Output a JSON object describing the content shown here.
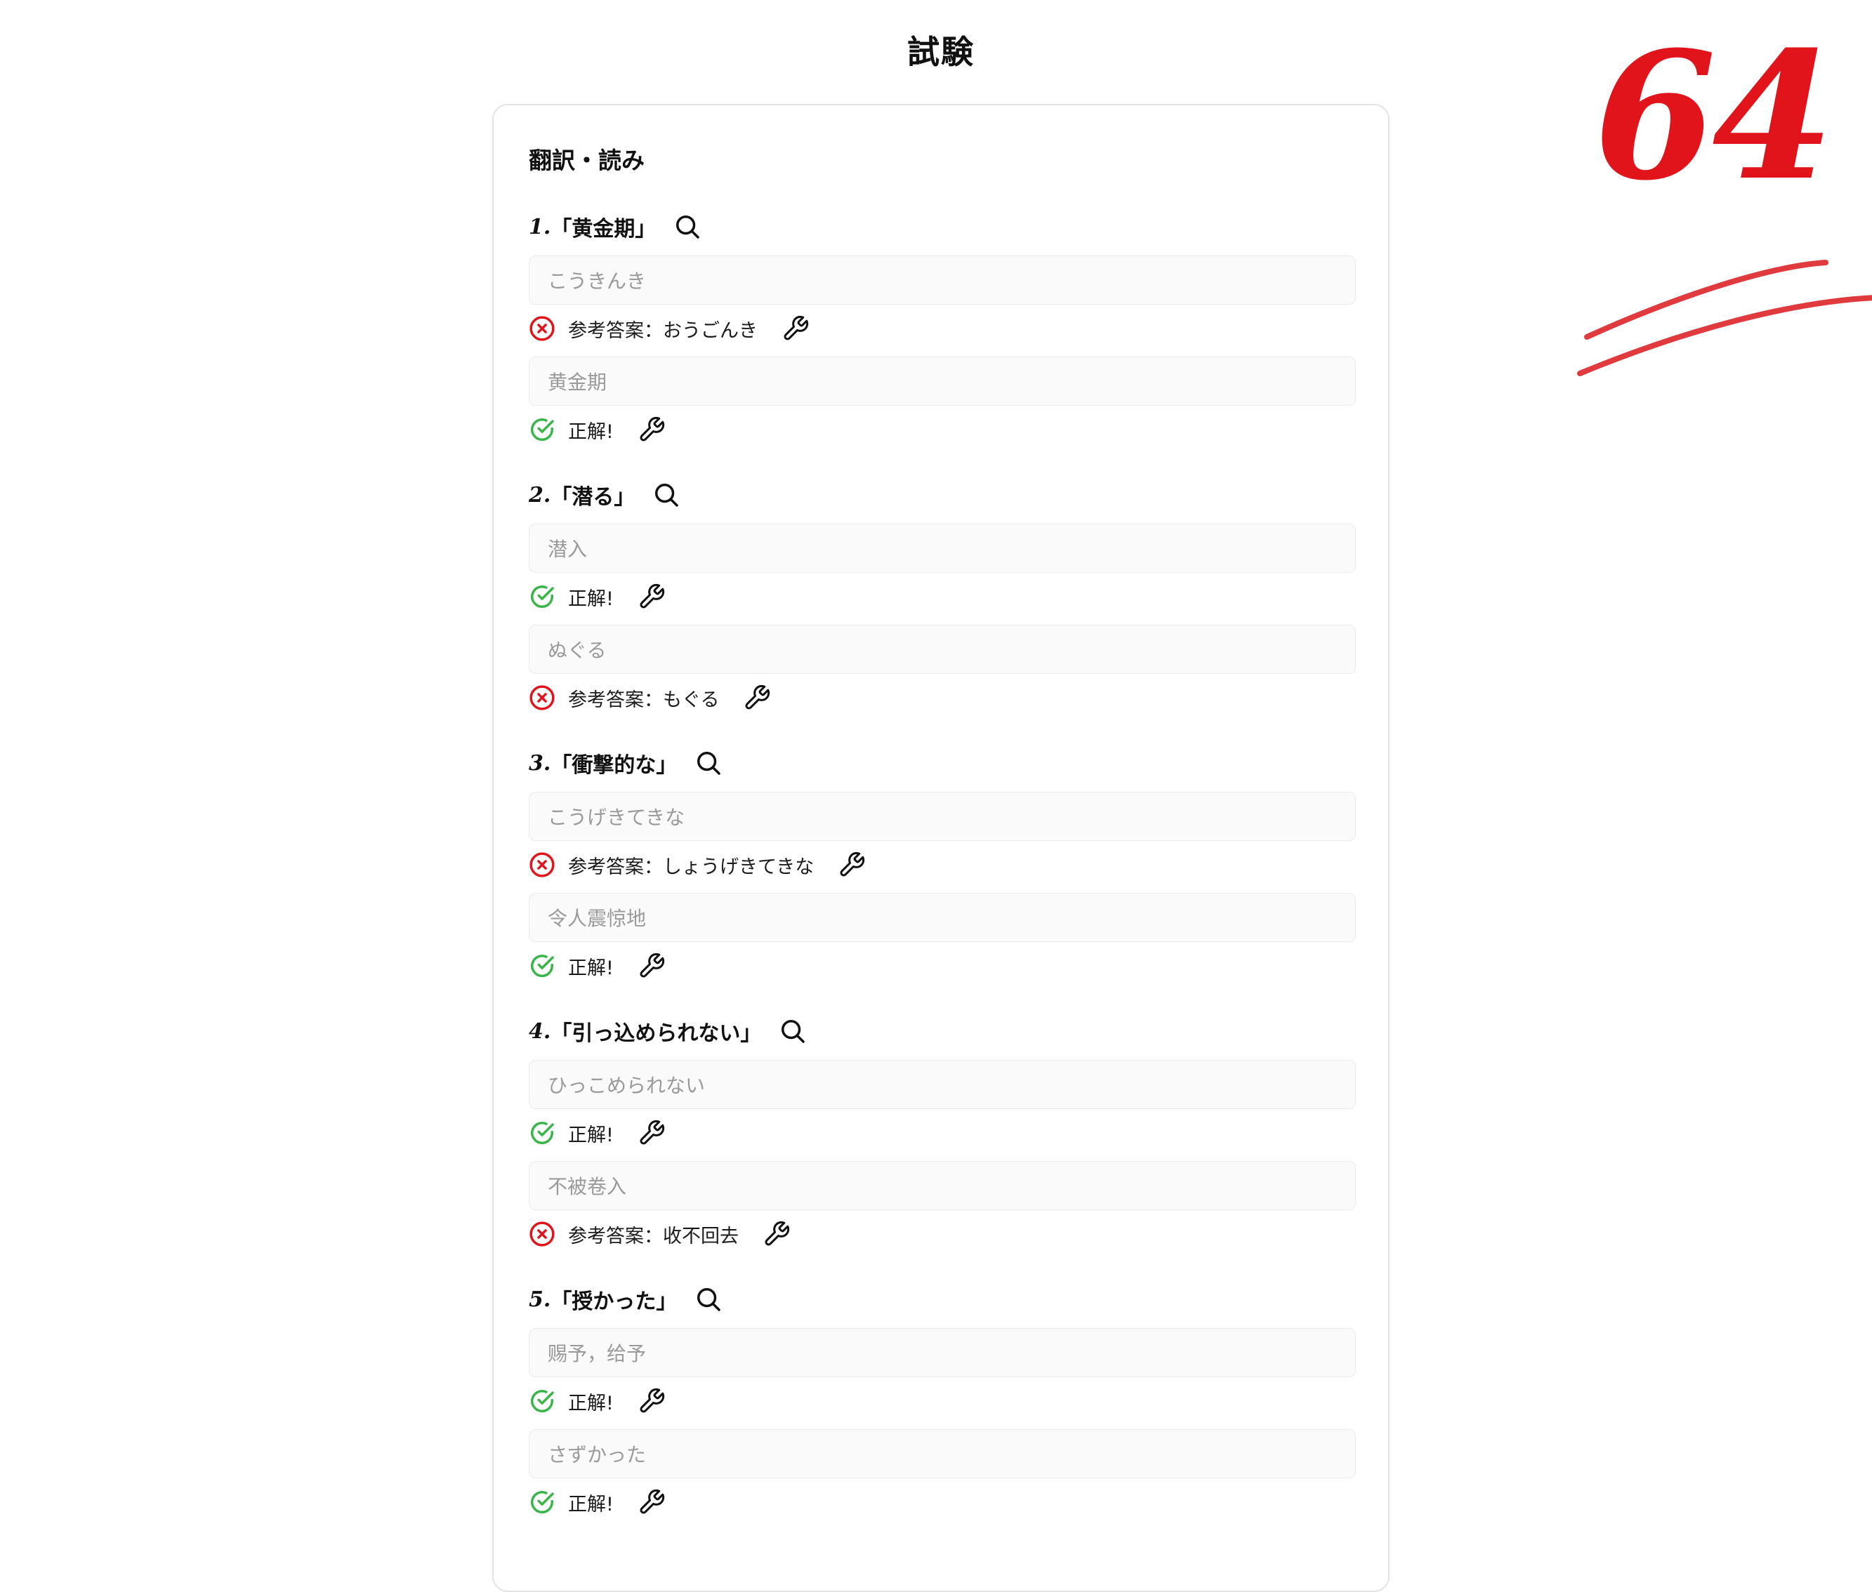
{
  "page": {
    "title": "試験",
    "score": "64"
  },
  "section": {
    "title": "翻訳・読み"
  },
  "colors": {
    "correct": "#3ab54a",
    "wrong": "#e2141b",
    "score": "#e2141b",
    "input_bg": "#fafafa",
    "card_border": "#e4e4e4"
  },
  "questions": [
    {
      "number": "1.",
      "prompt": "「黄金期」",
      "answers": [
        {
          "value": "こうきんき",
          "status": "wrong",
          "label": "参考答案：",
          "reference": "おうごんき"
        },
        {
          "value": "黄金期",
          "status": "correct",
          "label": "正解!",
          "reference": ""
        }
      ]
    },
    {
      "number": "2.",
      "prompt": "「潜る」",
      "answers": [
        {
          "value": "潜入",
          "status": "correct",
          "label": "正解!",
          "reference": ""
        },
        {
          "value": "ぬぐる",
          "status": "wrong",
          "label": "参考答案：",
          "reference": "もぐる"
        }
      ]
    },
    {
      "number": "3.",
      "prompt": "「衝撃的な」",
      "answers": [
        {
          "value": "こうげきてきな",
          "status": "wrong",
          "label": "参考答案：",
          "reference": "しょうげきてきな"
        },
        {
          "value": "令人震惊地",
          "status": "correct",
          "label": "正解!",
          "reference": ""
        }
      ]
    },
    {
      "number": "4.",
      "prompt": "「引っ込められない」",
      "answers": [
        {
          "value": "ひっこめられない",
          "status": "correct",
          "label": "正解!",
          "reference": ""
        },
        {
          "value": "不被卷入",
          "status": "wrong",
          "label": "参考答案：",
          "reference": "收不回去"
        }
      ]
    },
    {
      "number": "5.",
      "prompt": "「授かった」",
      "answers": [
        {
          "value": "赐予，给予",
          "status": "correct",
          "label": "正解!",
          "reference": ""
        },
        {
          "value": "さずかった",
          "status": "correct",
          "label": "正解!",
          "reference": ""
        }
      ]
    }
  ]
}
